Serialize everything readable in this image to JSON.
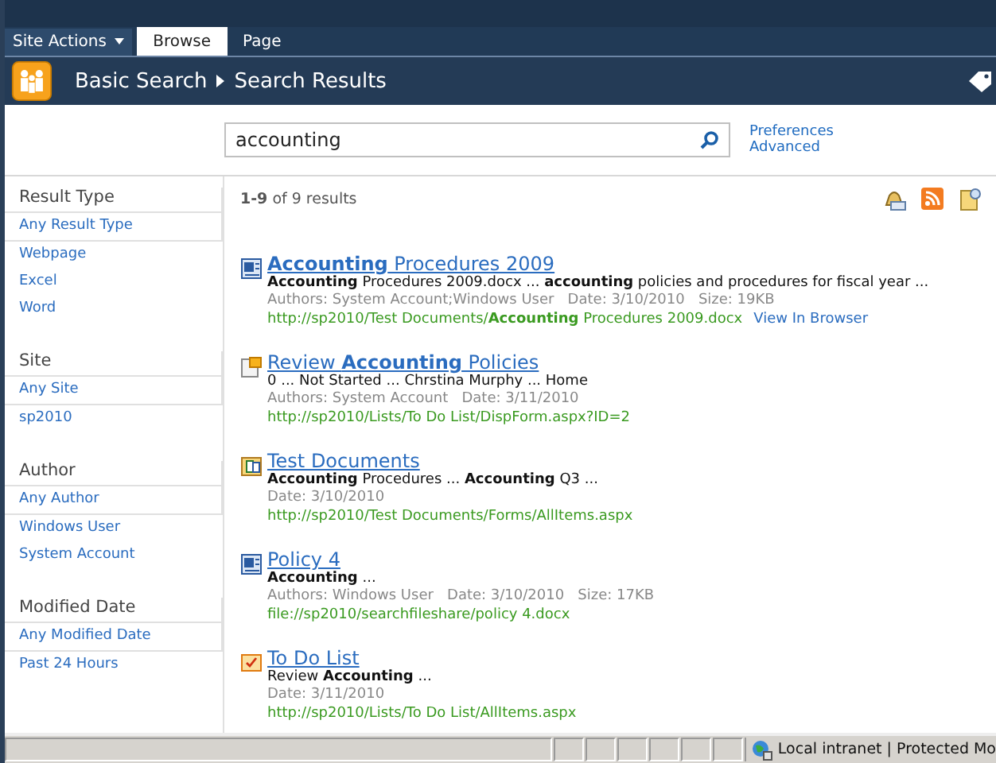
{
  "ribbon": {
    "site_actions": "Site Actions",
    "tabs": [
      {
        "label": "Browse",
        "selected": true
      },
      {
        "label": "Page",
        "selected": false
      }
    ]
  },
  "breadcrumb": [
    "Basic Search",
    "Search Results"
  ],
  "search": {
    "value": "accounting",
    "links": [
      "Preferences",
      "Advanced"
    ]
  },
  "refiners": [
    {
      "title": "Result Type",
      "items": [
        {
          "label": "Any Result Type",
          "selected": true
        },
        {
          "label": "Webpage",
          "selected": false
        },
        {
          "label": "Excel",
          "selected": false
        },
        {
          "label": "Word",
          "selected": false
        }
      ]
    },
    {
      "title": "Site",
      "items": [
        {
          "label": "Any Site",
          "selected": true
        },
        {
          "label": "sp2010",
          "selected": false
        }
      ]
    },
    {
      "title": "Author",
      "items": [
        {
          "label": "Any Author",
          "selected": true
        },
        {
          "label": "Windows User",
          "selected": false
        },
        {
          "label": "System Account",
          "selected": false
        }
      ]
    },
    {
      "title": "Modified Date",
      "items": [
        {
          "label": "Any Modified Date",
          "selected": true
        },
        {
          "label": "Past 24 Hours",
          "selected": false
        }
      ]
    }
  ],
  "count": "**1-9** of 9 results",
  "results": [
    {
      "kind": "word",
      "title": "**Accounting** Procedures 2009",
      "snippet": "**Accounting** Procedures 2009.docx ... **accounting** policies and procedures for fiscal year ...",
      "meta": "Authors: System Account;Windows User   Date: 3/10/2010   Size: 19KB",
      "url": "http://sp2010/Test Documents/**Accounting** Procedures 2009.docx",
      "link": "View In Browser"
    },
    {
      "kind": "task",
      "title": "Review **Accounting** Policies",
      "snippet": "0 ... Not Started ... Chrstina Murphy ... Home",
      "meta": "Authors: System Account   Date: 3/11/2010",
      "url": "http://sp2010/Lists/To Do List/DispForm.aspx?ID=2"
    },
    {
      "kind": "library",
      "title": "Test Documents",
      "snippet": "**Accounting** Procedures ... **Accounting** Q3 ...",
      "meta": "Date: 3/10/2010",
      "url": "http://sp2010/Test Documents/Forms/AllItems.aspx"
    },
    {
      "kind": "word",
      "title": "Policy 4",
      "snippet": "**Accounting** ...",
      "meta": "Authors: Windows User   Date: 3/10/2010   Size: 17KB",
      "url": "file://sp2010/searchfileshare/policy 4.docx"
    },
    {
      "kind": "tasklist",
      "title": "To Do List",
      "snippet": "Review **Accounting** ...",
      "meta": "Date: 3/11/2010",
      "url": "http://sp2010/Lists/To Do List/AllItems.aspx"
    }
  ],
  "status_bar": {
    "zone": "Local intranet | Protected Mo"
  }
}
